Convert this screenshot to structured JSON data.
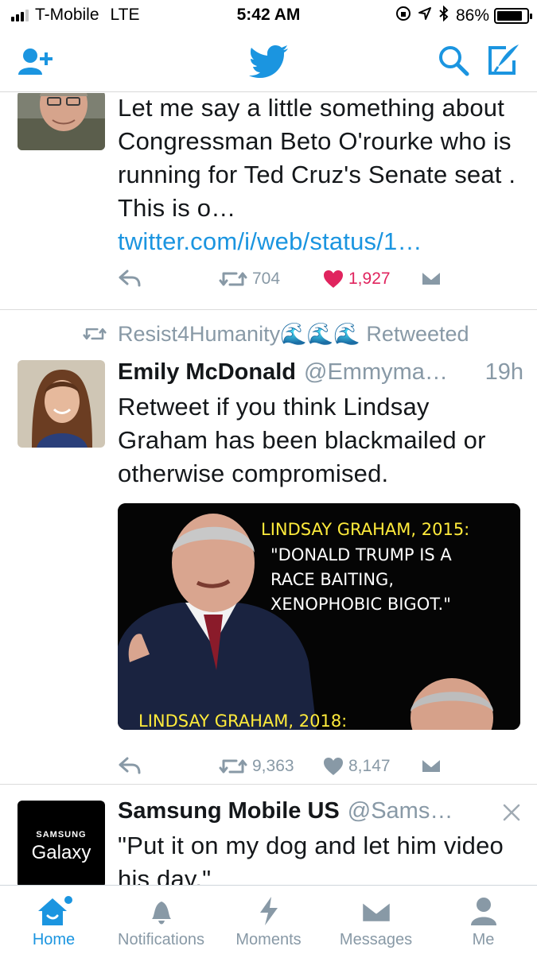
{
  "status_bar": {
    "carrier": "T-Mobile",
    "network": "LTE",
    "time": "5:42 AM",
    "battery": "86%",
    "battery_level": 0.86
  },
  "nav_bar": {
    "icons": [
      "add-user-icon",
      "twitter-bird-icon",
      "search-icon",
      "compose-icon"
    ]
  },
  "tweets": [
    {
      "text": "Let me say a little something about Congressman Beto O'rourke who is running for Ted Cruz's Senate seat . This is o…",
      "link": "twitter.com/i/web/status/1…",
      "retweets": "704",
      "likes": "1,927",
      "liked": true
    },
    {
      "retweeted_by": "Resist4Humanity🌊🌊🌊 Retweeted",
      "name": "Emily McDonald",
      "handle": "@Emmyma…",
      "time": "19h",
      "text": "Retweet if you think Lindsay Graham has been blackmailed or otherwise compromised.",
      "media": {
        "caption_title_1": "LINDSAY GRAHAM, 2015:",
        "caption_quote": "\"DONALD TRUMP IS A RACE BAITING, XENOPHOBIC BIGOT.\"",
        "caption_title_2": "LINDSAY GRAHAM, 2018:"
      },
      "retweets": "9,363",
      "likes": "8,147"
    },
    {
      "name": "Samsung Mobile US",
      "handle": "@Sams…",
      "avatar_brand_top": "SAMSUNG",
      "avatar_brand_bottom": "Galaxy",
      "text": "\"Put it on my dog and let him video his day.\""
    }
  ],
  "tab_bar": {
    "tabs": [
      {
        "label": "Home",
        "icon": "home-icon",
        "active": true
      },
      {
        "label": "Notifications",
        "icon": "bell-icon"
      },
      {
        "label": "Moments",
        "icon": "lightning-icon"
      },
      {
        "label": "Messages",
        "icon": "envelope-icon"
      },
      {
        "label": "Me",
        "icon": "person-icon"
      }
    ]
  },
  "colors": {
    "accent": "#1b95e0",
    "muted": "#8899a6",
    "like": "#e0245e"
  }
}
